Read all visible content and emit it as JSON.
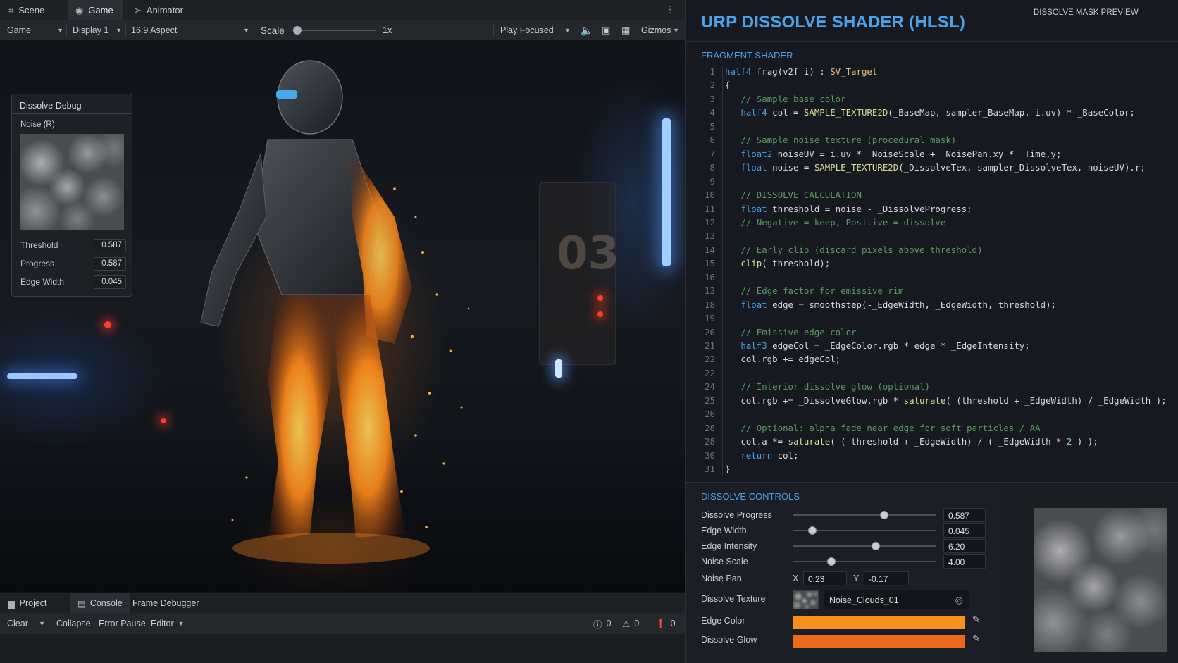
{
  "left": {
    "tabs": [
      {
        "label": "Scene",
        "icon": "scene-grid-icon"
      },
      {
        "label": "Game",
        "icon": "gamepad-icon"
      },
      {
        "label": "Animator",
        "icon": "animator-icon"
      }
    ],
    "toolbar": {
      "game_select": "Game",
      "display_select": "Display 1",
      "aspect_select": "16:9 Aspect",
      "scale_label": "Scale",
      "scale_value": "1x",
      "play_mode": "Play Focused",
      "gizmos_label": "Gizmos"
    },
    "scene_overlay": {
      "door_number": "03"
    },
    "debug_panel": {
      "title": "Dissolve Debug",
      "noise_label": "Noise (R)",
      "rows": [
        {
          "label": "Threshold",
          "value": "0.587"
        },
        {
          "label": "Progress",
          "value": "0.587"
        },
        {
          "label": "Edge Width",
          "value": "0.045"
        }
      ]
    },
    "bottom": {
      "tabs": [
        {
          "label": "Project",
          "icon": "folder-icon"
        },
        {
          "label": "Console",
          "icon": "console-icon"
        },
        {
          "label": "Frame Debugger",
          "icon": ""
        }
      ],
      "tools": {
        "clear": "Clear",
        "collapse": "Collapse",
        "error_pause": "Error Pause",
        "editor": "Editor",
        "log_count": "0",
        "warning_count": "0",
        "error_count": "0"
      }
    }
  },
  "right": {
    "title": "URP DISSOLVE SHADER (HLSL)",
    "fragment_label": "FRAGMENT SHADER",
    "code_lines": [
      {
        "n": "1",
        "html": "<span class=\"kw\">half4</span> frag(v2f i) : <span class=\"sem\">SV_Target</span>"
      },
      {
        "n": "2",
        "html": "{"
      },
      {
        "n": "3",
        "html": "   <span class=\"cm\">// Sample base color</span>"
      },
      {
        "n": "4",
        "html": "   <span class=\"kw\">half4</span> col = <span class=\"fn\">SAMPLE_TEXTURE2D</span>(_BaseMap, sampler_BaseMap, i.uv) * _BaseColor;"
      },
      {
        "n": "5",
        "html": ""
      },
      {
        "n": "6",
        "html": "   <span class=\"cm\">// Sample noise texture (procedural mask)</span>"
      },
      {
        "n": "7",
        "html": "   <span class=\"kw\">float2</span> noiseUV = i.uv * _NoiseScale + _NoisePan.xy * _Time.y;"
      },
      {
        "n": "8",
        "html": "   <span class=\"kw\">float</span> noise = <span class=\"fn\">SAMPLE_TEXTURE2D</span>(_DissolveTex, sampler_DissolveTex, noiseUV).r;"
      },
      {
        "n": "9",
        "html": ""
      },
      {
        "n": "10",
        "html": "   <span class=\"cm\">// DISSOLVE CALCULATION</span>"
      },
      {
        "n": "11",
        "html": "   <span class=\"kw\">float</span> threshold = noise - _DissolveProgress;"
      },
      {
        "n": "12",
        "html": "   <span class=\"cm\">// Negative = keep, Positive = dissolve</span>"
      },
      {
        "n": "13",
        "html": ""
      },
      {
        "n": "14",
        "html": "   <span class=\"cm\">// Early clip (discard pixels above threshold)</span>"
      },
      {
        "n": "15",
        "html": "   <span class=\"fn\">clip</span>(-threshold);"
      },
      {
        "n": "16",
        "html": ""
      },
      {
        "n": "13",
        "html": "   <span class=\"cm\">// Edge factor for emissive rim</span>"
      },
      {
        "n": "18",
        "html": "   <span class=\"kw\">float</span> edge = smoothstep(-_EdgeWidth, _EdgeWidth, threshold);"
      },
      {
        "n": "19",
        "html": ""
      },
      {
        "n": "20",
        "html": "   <span class=\"cm\">// Emissive edge color</span>"
      },
      {
        "n": "21",
        "html": "   <span class=\"kw\">half3</span> edgeCol = _EdgeColor.rgb * edge * _EdgeIntensity;"
      },
      {
        "n": "22",
        "html": "   col.rgb += edgeCol;"
      },
      {
        "n": "22",
        "html": ""
      },
      {
        "n": "24",
        "html": "   <span class=\"cm\">// Interior dissolve glow (optional)</span>"
      },
      {
        "n": "25",
        "html": "   col.rgb += _DissolveGlow.rgb * <span class=\"fn\">saturate</span>( (threshold + _EdgeWidth) / _EdgeWidth );"
      },
      {
        "n": "26",
        "html": ""
      },
      {
        "n": "28",
        "html": "   <span class=\"cm\">// Optional: alpha fade near edge for soft particles / AA</span>"
      },
      {
        "n": "28",
        "html": "   col.a *= <span class=\"fn\">saturate</span>( (-threshold + _EdgeWidth) / ( _EdgeWidth * <span class=\"num\">2</span> ) );"
      },
      {
        "n": "30",
        "html": "   <span class=\"kw\">return</span> col;"
      },
      {
        "n": "31",
        "html": "}"
      }
    ],
    "controls": {
      "title": "DISSOLVE CONTROLS",
      "sliders": [
        {
          "label": "Dissolve Progress",
          "value": "0.587",
          "fraction": 0.64
        },
        {
          "label": "Edge Width",
          "value": "0.045",
          "fraction": 0.14
        },
        {
          "label": "Edge Intensity",
          "value": "6.20",
          "fraction": 0.58
        },
        {
          "label": "Noise Scale",
          "value": "4.00",
          "fraction": 0.27
        }
      ],
      "noise_pan": {
        "label": "Noise Pan",
        "x_label": "X",
        "x": "0.23",
        "y_label": "Y",
        "y": "-0.17"
      },
      "texture": {
        "label": "Dissolve Texture",
        "value": "Noise_Clouds_01"
      },
      "edge_color": {
        "label": "Edge Color",
        "color": "#f7901e"
      },
      "dissolve_glow": {
        "label": "Dissolve Glow",
        "color": "#ec6a1c"
      }
    },
    "preview": {
      "title": "DISSOLVE MASK PREVIEW"
    }
  },
  "colors": {
    "accent": "#4aa3ea",
    "edge_color": "#f7901e",
    "dissolve_glow": "#ec6a1c"
  }
}
